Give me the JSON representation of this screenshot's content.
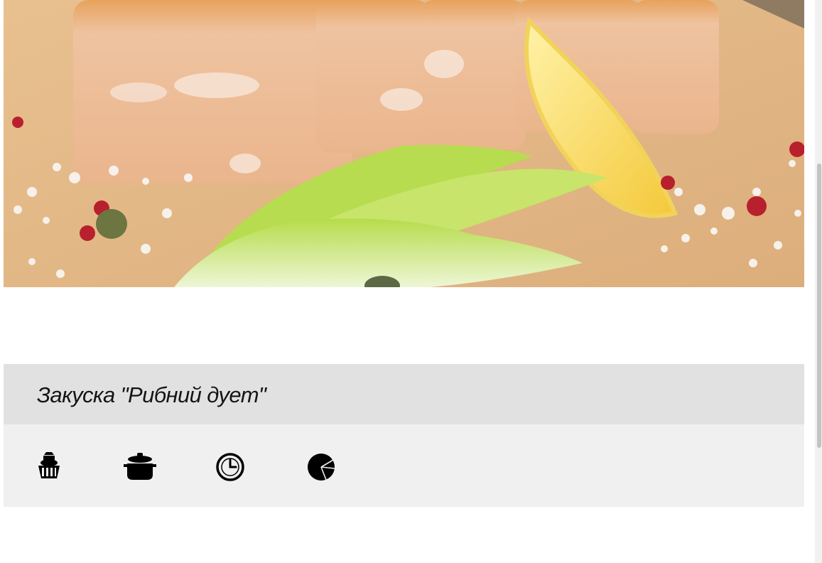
{
  "recipe": {
    "title": "Закуска \"Рибний дует\""
  },
  "hero_image": {
    "alt": "",
    "colors": {
      "board": "#e2b98a",
      "terrine": "#e9b487",
      "lettuce": "#c9e37b",
      "lemon": "#f7d65a"
    }
  },
  "info_icons": [
    {
      "name": "ingredients-basket-icon"
    },
    {
      "name": "cooking-pot-icon"
    },
    {
      "name": "clock-icon"
    },
    {
      "name": "pie-chart-icon"
    }
  ],
  "colors": {
    "title_bar": "#e1e1e1",
    "icon_bar": "#f0f0f0",
    "icon": "#000000",
    "title_text": "#141414"
  }
}
